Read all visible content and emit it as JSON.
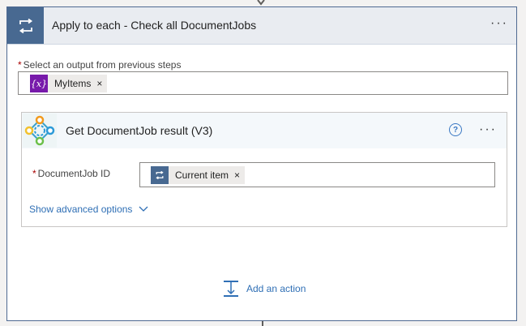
{
  "loop": {
    "title": "Apply to each - Check all DocumentJobs",
    "more": "···",
    "output_label": "Select an output from previous steps",
    "required_mark": "*",
    "token": {
      "label": "MyItems",
      "icon": "{x}",
      "remove": "×"
    }
  },
  "action": {
    "title": "Get DocumentJob result (V3)",
    "help": "?",
    "more": "···",
    "field_label": "DocumentJob ID",
    "required_mark": "*",
    "token": {
      "label": "Current item",
      "remove": "×"
    },
    "advanced_label": "Show advanced options"
  },
  "add_action_label": "Add an action",
  "colors": {
    "loop_accent": "#486991",
    "variable_token": "#7719aa",
    "link": "#2f6fb5"
  }
}
